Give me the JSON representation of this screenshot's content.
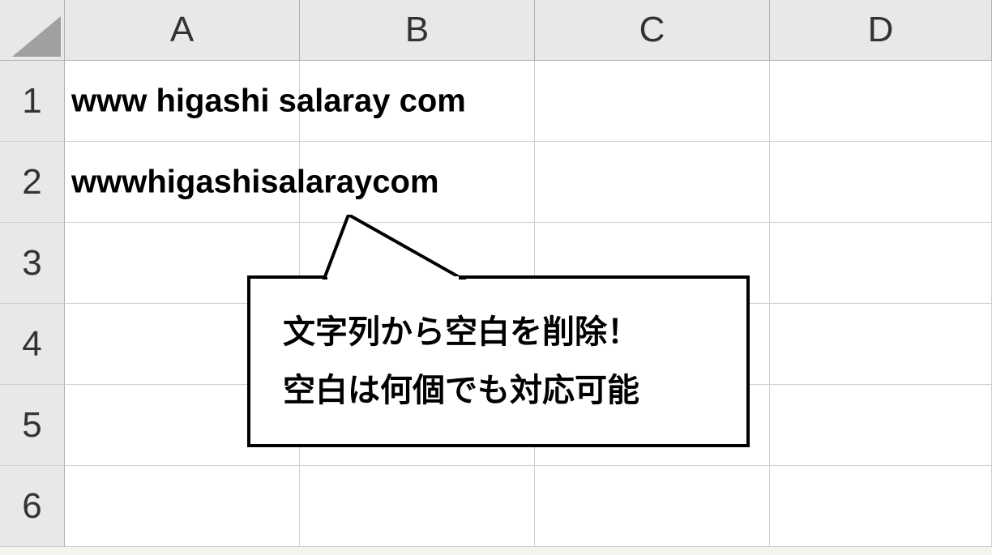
{
  "columns": [
    "A",
    "B",
    "C",
    "D"
  ],
  "rows": [
    "1",
    "2",
    "3",
    "4",
    "5",
    "6"
  ],
  "cells": {
    "A1": "www   higashi  salaray com",
    "A2": "wwwhigashisalaraycom"
  },
  "callout": {
    "line1": "文字列から空白を削除！",
    "line2": "空白は何個でも対応可能"
  }
}
